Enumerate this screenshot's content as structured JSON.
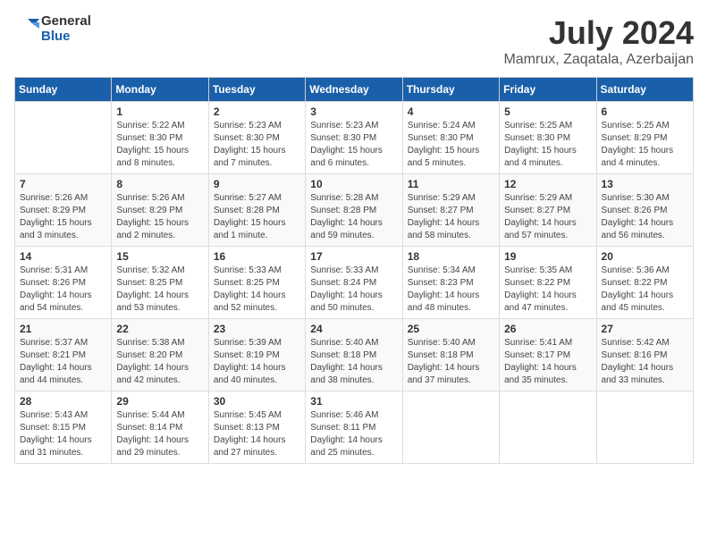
{
  "logo": {
    "general": "General",
    "blue": "Blue"
  },
  "title": {
    "month": "July 2024",
    "location": "Mamrux, Zaqatala, Azerbaijan"
  },
  "days_of_week": [
    "Sunday",
    "Monday",
    "Tuesday",
    "Wednesday",
    "Thursday",
    "Friday",
    "Saturday"
  ],
  "weeks": [
    [
      {
        "day": "",
        "info": ""
      },
      {
        "day": "1",
        "info": "Sunrise: 5:22 AM\nSunset: 8:30 PM\nDaylight: 15 hours\nand 8 minutes."
      },
      {
        "day": "2",
        "info": "Sunrise: 5:23 AM\nSunset: 8:30 PM\nDaylight: 15 hours\nand 7 minutes."
      },
      {
        "day": "3",
        "info": "Sunrise: 5:23 AM\nSunset: 8:30 PM\nDaylight: 15 hours\nand 6 minutes."
      },
      {
        "day": "4",
        "info": "Sunrise: 5:24 AM\nSunset: 8:30 PM\nDaylight: 15 hours\nand 5 minutes."
      },
      {
        "day": "5",
        "info": "Sunrise: 5:25 AM\nSunset: 8:30 PM\nDaylight: 15 hours\nand 4 minutes."
      },
      {
        "day": "6",
        "info": "Sunrise: 5:25 AM\nSunset: 8:29 PM\nDaylight: 15 hours\nand 4 minutes."
      }
    ],
    [
      {
        "day": "7",
        "info": "Sunrise: 5:26 AM\nSunset: 8:29 PM\nDaylight: 15 hours\nand 3 minutes."
      },
      {
        "day": "8",
        "info": "Sunrise: 5:26 AM\nSunset: 8:29 PM\nDaylight: 15 hours\nand 2 minutes."
      },
      {
        "day": "9",
        "info": "Sunrise: 5:27 AM\nSunset: 8:28 PM\nDaylight: 15 hours\nand 1 minute."
      },
      {
        "day": "10",
        "info": "Sunrise: 5:28 AM\nSunset: 8:28 PM\nDaylight: 14 hours\nand 59 minutes."
      },
      {
        "day": "11",
        "info": "Sunrise: 5:29 AM\nSunset: 8:27 PM\nDaylight: 14 hours\nand 58 minutes."
      },
      {
        "day": "12",
        "info": "Sunrise: 5:29 AM\nSunset: 8:27 PM\nDaylight: 14 hours\nand 57 minutes."
      },
      {
        "day": "13",
        "info": "Sunrise: 5:30 AM\nSunset: 8:26 PM\nDaylight: 14 hours\nand 56 minutes."
      }
    ],
    [
      {
        "day": "14",
        "info": "Sunrise: 5:31 AM\nSunset: 8:26 PM\nDaylight: 14 hours\nand 54 minutes."
      },
      {
        "day": "15",
        "info": "Sunrise: 5:32 AM\nSunset: 8:25 PM\nDaylight: 14 hours\nand 53 minutes."
      },
      {
        "day": "16",
        "info": "Sunrise: 5:33 AM\nSunset: 8:25 PM\nDaylight: 14 hours\nand 52 minutes."
      },
      {
        "day": "17",
        "info": "Sunrise: 5:33 AM\nSunset: 8:24 PM\nDaylight: 14 hours\nand 50 minutes."
      },
      {
        "day": "18",
        "info": "Sunrise: 5:34 AM\nSunset: 8:23 PM\nDaylight: 14 hours\nand 48 minutes."
      },
      {
        "day": "19",
        "info": "Sunrise: 5:35 AM\nSunset: 8:22 PM\nDaylight: 14 hours\nand 47 minutes."
      },
      {
        "day": "20",
        "info": "Sunrise: 5:36 AM\nSunset: 8:22 PM\nDaylight: 14 hours\nand 45 minutes."
      }
    ],
    [
      {
        "day": "21",
        "info": "Sunrise: 5:37 AM\nSunset: 8:21 PM\nDaylight: 14 hours\nand 44 minutes."
      },
      {
        "day": "22",
        "info": "Sunrise: 5:38 AM\nSunset: 8:20 PM\nDaylight: 14 hours\nand 42 minutes."
      },
      {
        "day": "23",
        "info": "Sunrise: 5:39 AM\nSunset: 8:19 PM\nDaylight: 14 hours\nand 40 minutes."
      },
      {
        "day": "24",
        "info": "Sunrise: 5:40 AM\nSunset: 8:18 PM\nDaylight: 14 hours\nand 38 minutes."
      },
      {
        "day": "25",
        "info": "Sunrise: 5:40 AM\nSunset: 8:18 PM\nDaylight: 14 hours\nand 37 minutes."
      },
      {
        "day": "26",
        "info": "Sunrise: 5:41 AM\nSunset: 8:17 PM\nDaylight: 14 hours\nand 35 minutes."
      },
      {
        "day": "27",
        "info": "Sunrise: 5:42 AM\nSunset: 8:16 PM\nDaylight: 14 hours\nand 33 minutes."
      }
    ],
    [
      {
        "day": "28",
        "info": "Sunrise: 5:43 AM\nSunset: 8:15 PM\nDaylight: 14 hours\nand 31 minutes."
      },
      {
        "day": "29",
        "info": "Sunrise: 5:44 AM\nSunset: 8:14 PM\nDaylight: 14 hours\nand 29 minutes."
      },
      {
        "day": "30",
        "info": "Sunrise: 5:45 AM\nSunset: 8:13 PM\nDaylight: 14 hours\nand 27 minutes."
      },
      {
        "day": "31",
        "info": "Sunrise: 5:46 AM\nSunset: 8:11 PM\nDaylight: 14 hours\nand 25 minutes."
      },
      {
        "day": "",
        "info": ""
      },
      {
        "day": "",
        "info": ""
      },
      {
        "day": "",
        "info": ""
      }
    ]
  ]
}
